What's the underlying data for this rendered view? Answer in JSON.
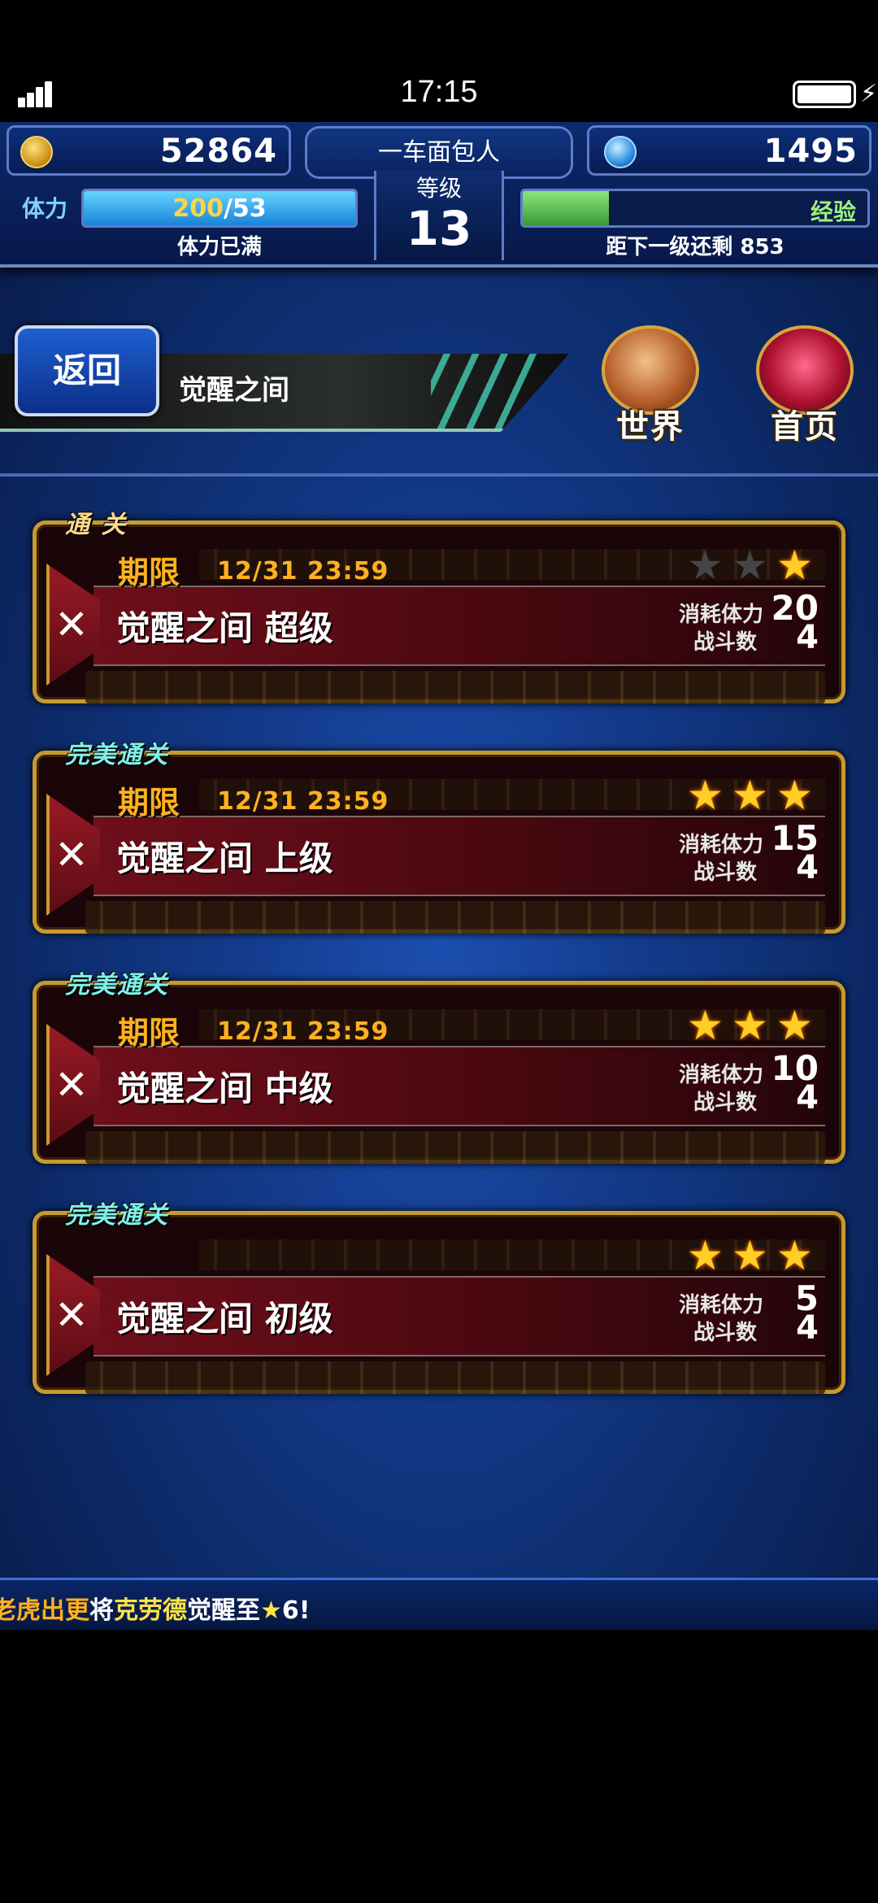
{
  "status_bar": {
    "time": "17:15"
  },
  "player": {
    "gil": "52864",
    "name": "一车面包人",
    "level_label": "等级",
    "level": "13",
    "gems": "1495",
    "stamina_label": "体力",
    "stamina_current": "200",
    "stamina_max": "/53",
    "stamina_fill": 1.0,
    "stamina_status": "体力已满",
    "exp_label": "经验",
    "exp_fill": 0.25,
    "exp_remaining": "距下一级还剩 853"
  },
  "header": {
    "back_label": "返回",
    "title": "觉醒之间",
    "world_label": "世界",
    "home_label": "首页"
  },
  "labels": {
    "cost": "消耗体力",
    "battles": "战斗数",
    "deadline": "期限"
  },
  "stages": [
    {
      "badge": "通 关",
      "badge_type": "clear",
      "deadline_time": "12/31  23:59",
      "name": "觉醒之间 超级",
      "stars": 1,
      "cost": "20",
      "battles": "4",
      "has_deadline": true
    },
    {
      "badge": "完美通关",
      "badge_type": "perfect",
      "deadline_time": "12/31  23:59",
      "name": "觉醒之间 上级",
      "stars": 3,
      "cost": "15",
      "battles": "4",
      "has_deadline": true
    },
    {
      "badge": "完美通关",
      "badge_type": "perfect",
      "deadline_time": "12/31  23:59",
      "name": "觉醒之间 中级",
      "stars": 3,
      "cost": "10",
      "battles": "4",
      "has_deadline": true
    },
    {
      "badge": "完美通关",
      "badge_type": "perfect",
      "deadline_time": "",
      "name": "觉醒之间 初级",
      "stars": 3,
      "cost": "5",
      "battles": "4",
      "has_deadline": false
    }
  ],
  "ticker": {
    "player": "老虎出更",
    "verb": "将",
    "character": "克劳德",
    "action": "觉醒至",
    "star": "★",
    "rank": "6!"
  },
  "colors": {
    "accent_gold": "#c79a2f",
    "deadline_orange": "#ffb11f",
    "star_on": "#ffcf25"
  }
}
